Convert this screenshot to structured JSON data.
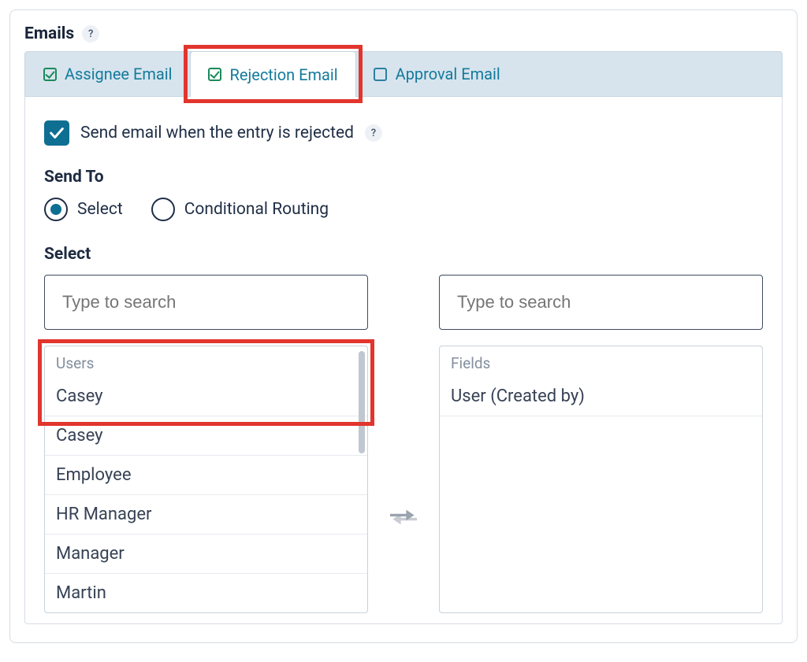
{
  "header": {
    "title": "Emails",
    "help": "?"
  },
  "tabs": [
    {
      "label": "Assignee Email",
      "checked": true,
      "active": false
    },
    {
      "label": "Rejection Email",
      "checked": true,
      "active": true
    },
    {
      "label": "Approval Email",
      "checked": false,
      "active": false
    }
  ],
  "send_option": {
    "checked": true,
    "label": "Send email when the entry is rejected",
    "help": "?"
  },
  "send_to": {
    "title": "Send To",
    "options": [
      {
        "label": "Select",
        "selected": true
      },
      {
        "label": "Conditional Routing",
        "selected": false
      }
    ]
  },
  "selector": {
    "title": "Select",
    "left": {
      "search_placeholder": "Type to search",
      "group_header": "Users",
      "items": [
        "Casey",
        "Casey",
        "Employee",
        "HR Manager",
        "Manager",
        "Martin"
      ]
    },
    "right": {
      "search_placeholder": "Type to search",
      "group_header": "Fields",
      "items": [
        "User (Created by)"
      ]
    }
  }
}
